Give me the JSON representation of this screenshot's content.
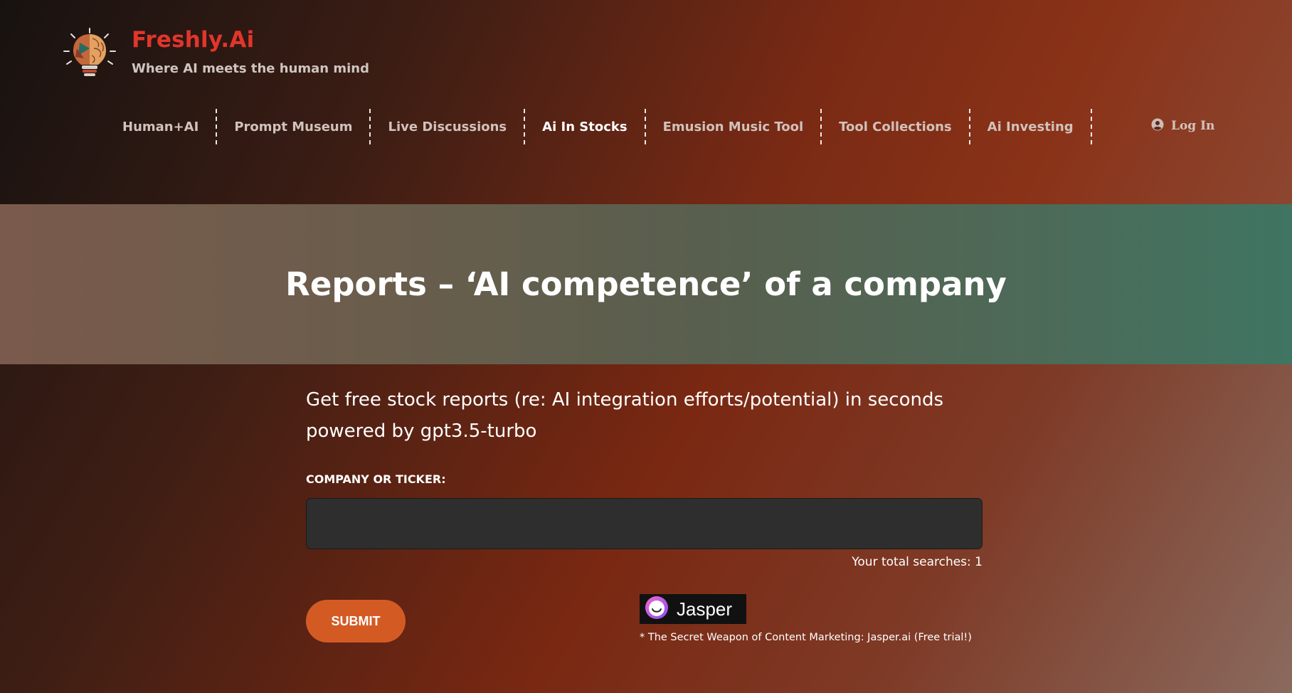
{
  "brand": {
    "name": "Freshly.Ai",
    "tagline": "Where AI meets the human mind"
  },
  "nav": {
    "items": [
      {
        "label": "Human+AI"
      },
      {
        "label": "Prompt Museum"
      },
      {
        "label": "Live Discussions"
      },
      {
        "label": "Ai In Stocks"
      },
      {
        "label": "Emusion Music Tool"
      },
      {
        "label": "Tool Collections"
      },
      {
        "label": "Ai Investing"
      }
    ],
    "active": "Ai In Stocks",
    "login_label": "Log In"
  },
  "banner": {
    "title": "Reports – ‘AI competence’ of a company"
  },
  "content": {
    "intro_line1": "Get free stock reports (re: AI integration efforts/potential) in seconds",
    "intro_line2": "powered by gpt3.5-turbo",
    "field_label": "COMPANY OR TICKER:",
    "input_value": "",
    "search_count": "Your total searches: 1",
    "submit_label": "SUBMIT"
  },
  "promo": {
    "badge_name": "Jasper",
    "text": "* The Secret Weapon of Content Marketing: Jasper.ai (Free trial!)"
  },
  "colors": {
    "brand_red": "#e2352b",
    "submit_orange": "#d45a24",
    "banner_green": "#3f7562",
    "input_bg": "#2e2e2e"
  },
  "icons": {
    "logo": "lightbulb-brain-icon",
    "login": "user-circle-icon",
    "jasper": "jasper-logo-icon"
  }
}
